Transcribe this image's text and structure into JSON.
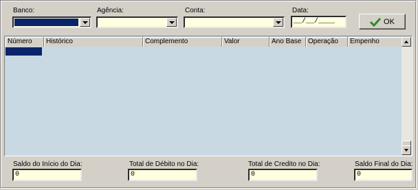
{
  "filters": {
    "banco_label": "Banco:",
    "agencia_label": "Agência:",
    "conta_label": "Conta:",
    "data_label": "Data:",
    "data_value": "__/__/____",
    "ok_label": "OK"
  },
  "grid": {
    "columns": [
      "Número",
      "Histórico",
      "Complemento",
      "Valor",
      "Ano Base",
      "Operação",
      "Empenho"
    ]
  },
  "totals": {
    "saldo_inicio_label": "Saldo do Início do Dia:",
    "saldo_inicio_value": "0",
    "total_debito_label": "Total de Débito no Dia:",
    "total_debito_value": "0",
    "total_credito_label": "Total de Credito no Dia:",
    "total_credito_value": "0",
    "saldo_final_label": "Saldo Final do Dia:",
    "saldo_final_value": "0"
  },
  "colors": {
    "field_bg": "#ffffe0",
    "grid_bg": "#c9d9e3",
    "selection": "#0a246a",
    "ok_check": "#2a8a2a"
  }
}
